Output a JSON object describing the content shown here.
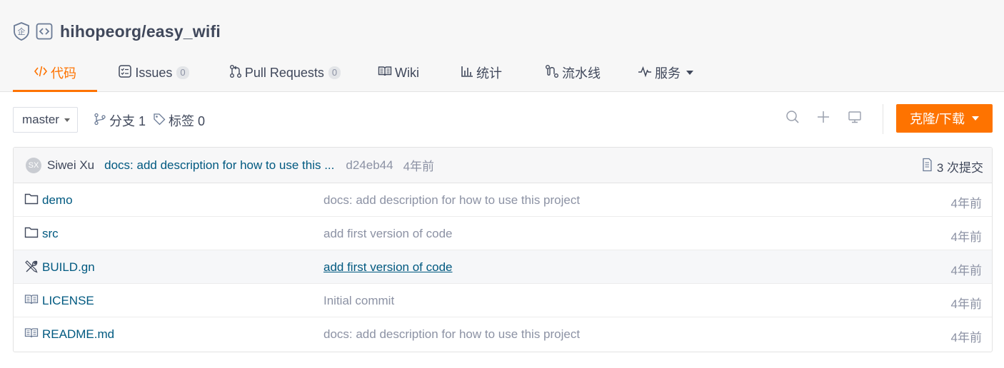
{
  "repo": {
    "title": "hihopeorg/easy_wifi"
  },
  "tabs": [
    {
      "label": "代码",
      "icon": "code-icon",
      "active": true
    },
    {
      "label": "Issues",
      "icon": "issues-icon",
      "count": "0"
    },
    {
      "label": "Pull Requests",
      "icon": "pull-request-icon",
      "count": "0"
    },
    {
      "label": "Wiki",
      "icon": "wiki-book-icon"
    },
    {
      "label": "统计",
      "icon": "bar-chart-icon"
    },
    {
      "label": "流水线",
      "icon": "pipeline-icon"
    },
    {
      "label": "服务",
      "icon": "pulse-icon"
    }
  ],
  "toolbar": {
    "branch": "master",
    "branches_label": "分支 1",
    "tags_label": "标签 0",
    "clone_label": "克隆/下载"
  },
  "commit": {
    "avatar": "SX",
    "author": "Siwei Xu",
    "message": "docs: add description for how to use this ...",
    "sha": "d24eb44",
    "time": "4年前",
    "count_label": "3 次提交"
  },
  "files": [
    {
      "name": "demo",
      "type": "folder",
      "message": "docs: add description for how to use this project",
      "time": "4年前"
    },
    {
      "name": "src",
      "type": "folder",
      "message": "add first version of code",
      "time": "4年前"
    },
    {
      "name": "BUILD.gn",
      "type": "build",
      "message": "add first version of code",
      "time": "4年前"
    },
    {
      "name": "LICENSE",
      "type": "doc",
      "message": "Initial commit",
      "time": "4年前"
    },
    {
      "name": "README.md",
      "type": "doc",
      "message": "docs: add description for how to use this project",
      "time": "4年前"
    }
  ],
  "colors": {
    "accent": "#fe7300",
    "link": "#005980",
    "muted": "#8c92a4",
    "text": "#40485b"
  }
}
